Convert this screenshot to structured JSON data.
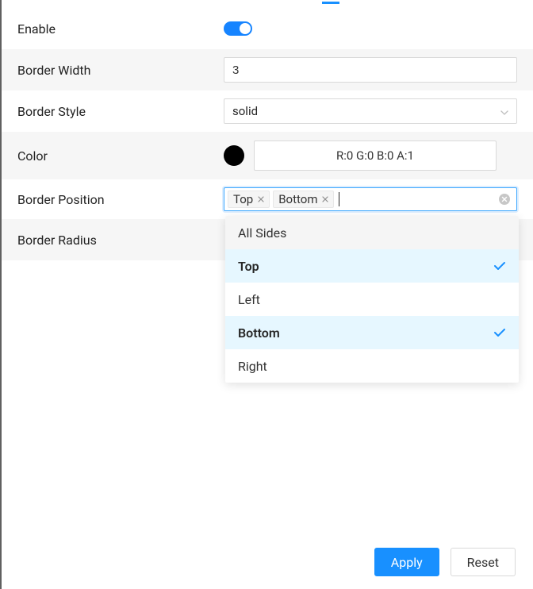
{
  "labels": {
    "enable": "Enable",
    "border_width": "Border Width",
    "border_style": "Border Style",
    "color": "Color",
    "border_position": "Border Position",
    "border_radius": "Border Radius"
  },
  "values": {
    "enable": true,
    "border_width": "3",
    "border_style": "solid",
    "color_rgba": "R:0 G:0 B:0 A:1",
    "color_hex": "#000000",
    "border_position_selected": [
      "Top",
      "Bottom"
    ]
  },
  "tags": {
    "t0": "Top",
    "t1": "Bottom"
  },
  "dropdown": {
    "header": "All Sides",
    "o_top": "Top",
    "o_left": "Left",
    "o_bottom": "Bottom",
    "o_right": "Right"
  },
  "buttons": {
    "apply": "Apply",
    "reset": "Reset"
  }
}
